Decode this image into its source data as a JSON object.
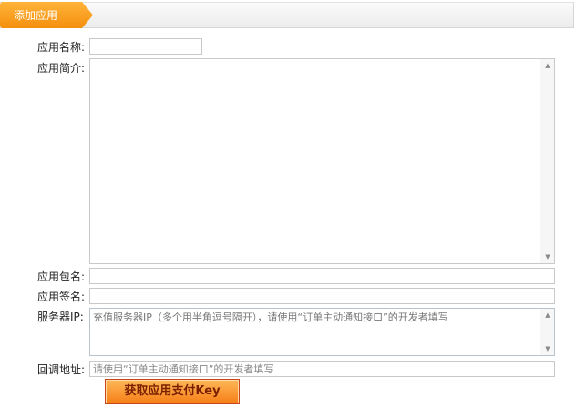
{
  "header": {
    "tab_label": "添加应用"
  },
  "form": {
    "app_name_label": "应用名称:",
    "app_intro_label": "应用简介:",
    "package_label": "应用包名:",
    "signature_label": "应用签名:",
    "server_ip_label": "服务器IP:",
    "server_ip_placeholder": "充值服务器IP（多个用半角逗号隔开），请使用“订单主动通知接口”的开发者填写",
    "callback_label": "回调地址:",
    "callback_placeholder": "请使用“订单主动通知接口”的开发者填写",
    "submit_label": "获取应用支付Key"
  }
}
